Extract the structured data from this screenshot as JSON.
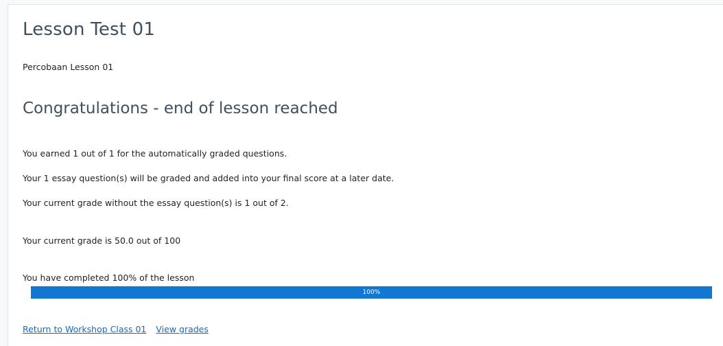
{
  "lesson": {
    "title": "Lesson Test 01",
    "description": "Percobaan Lesson 01"
  },
  "end_heading": "Congratulations - end of lesson reached",
  "messages": {
    "auto_graded": "You earned 1 out of 1 for the automatically graded questions.",
    "essay_pending": "Your 1 essay question(s) will be graded and added into your final score at a later date.",
    "grade_without_essay": "Your current grade without the essay question(s) is 1 out of 2.",
    "current_grade": "Your current grade is 50.0 out of 100",
    "completed": "You have completed 100% of the lesson"
  },
  "progress": {
    "percent": 100,
    "label": "100%",
    "color": "#1177d1"
  },
  "links": {
    "return": "Return to Workshop Class 01",
    "view_grades": "View grades"
  }
}
